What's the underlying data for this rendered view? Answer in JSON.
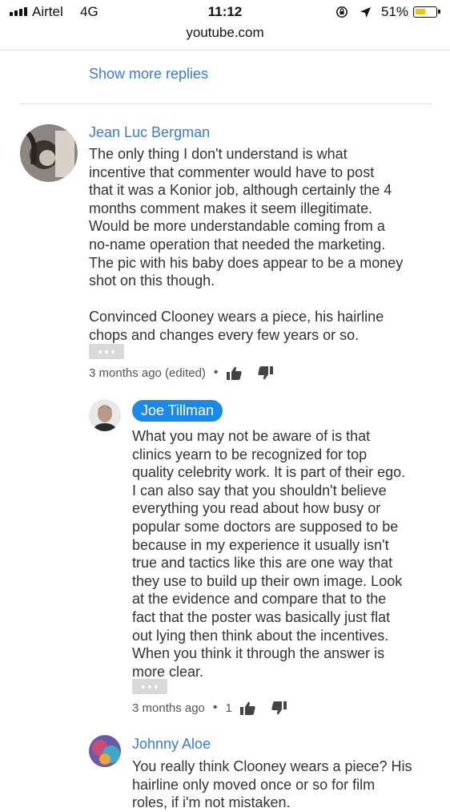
{
  "status_bar": {
    "carrier": "Airtel",
    "network": "4G",
    "time": "11:12",
    "battery_percent": "51%",
    "battery_level": 0.51
  },
  "browser": {
    "url": "youtube.com"
  },
  "thread": {
    "show_more_replies": "Show more replies"
  },
  "comments": [
    {
      "author": "Jean Luc Bergman",
      "text": "The only thing I don't understand is what\nincentive that commenter would have to post\nthat it was a Konior job, although certainly the 4\nmonths comment makes it seem illegitimate.\nWould be more understandable coming from a\nno-name operation that needed the marketing.\nThe pic with his baby does appear to be a money\nshot on this though.\n\nConvinced Clooney wears a piece, his hairline\nchops and changes every few years or so.",
      "time": "3 months ago (edited)",
      "separator": "•",
      "likes": ""
    },
    {
      "author": "Joe Tillman",
      "text": "What you may not be aware of is that\nclinics yearn to be recognized for top\nquality celebrity work. It is part of their ego.\nI can also say that you shouldn't believe\neverything you read about how busy or\npopular some doctors are supposed to be\nbecause in my experience it usually isn't\ntrue and tactics like this are one way that\nthey use to build up their own image. Look\nat the evidence and compare that to the\nfact that the poster was basically just flat\nout lying then think about the incentives.\nWhen you think it through the answer is\nmore clear.",
      "time": "3 months ago",
      "separator": "•",
      "likes": "1"
    },
    {
      "author": "Johnny Aloe",
      "text": "You really think Clooney wears a piece? His\nhairline only moved once or so for film\nroles, if i'm not mistaken."
    }
  ],
  "icons": {
    "like": "thumbs-up-icon",
    "dislike": "thumbs-down-icon",
    "more": "ellipsis-icon",
    "signal": "signal-bars-icon",
    "orientation_lock": "rotation-lock-icon",
    "location": "location-arrow-icon",
    "battery": "battery-icon"
  },
  "colors": {
    "link": "#3a7bd5",
    "highlight_pill": "#1a8ae6",
    "battery_fill": "#f5c400"
  }
}
